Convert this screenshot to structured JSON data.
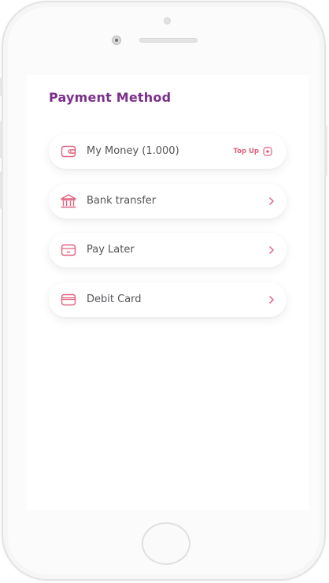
{
  "screen": {
    "title": "Payment Method"
  },
  "payment_methods": [
    {
      "label": "My Money (1.000)",
      "icon": "wallet-icon",
      "action": "Top Up",
      "action_icon": "plus-circle-icon"
    },
    {
      "label": "Bank transfer",
      "icon": "bank-icon",
      "action_icon": "chevron-right-icon"
    },
    {
      "label": "Pay Later",
      "icon": "card-icon",
      "action_icon": "chevron-right-icon"
    },
    {
      "label": "Debit Card",
      "icon": "credit-card-icon",
      "action_icon": "chevron-right-icon"
    }
  ],
  "colors": {
    "title": "#7b2f8a",
    "accent": "#e0607e",
    "label": "#555559"
  }
}
